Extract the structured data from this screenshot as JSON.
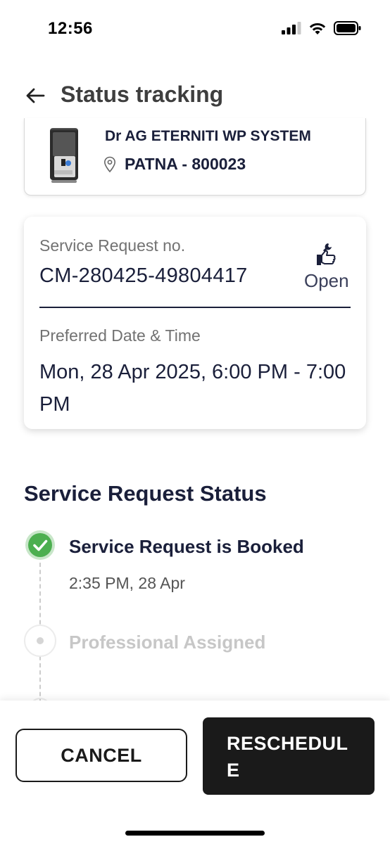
{
  "status_bar": {
    "time": "12:56",
    "icons": [
      "signal-icon",
      "wifi-icon",
      "battery-icon"
    ]
  },
  "header": {
    "back_icon": "arrow-left-icon",
    "title": "Status tracking"
  },
  "product": {
    "name": "Dr AG ETERNITI WP SYSTEM",
    "location": "PATNA - 800023",
    "location_icon": "map-pin-icon"
  },
  "request": {
    "label": "Service Request no.",
    "number": "CM-280425-49804417",
    "status": "Open",
    "status_icon": "thumbs-up-wrench-icon",
    "preferred_label": "Preferred Date & Time",
    "preferred_value": "Mon, 28 Apr 2025, 6:00 PM - 7:00 PM"
  },
  "timeline": {
    "title": "Service Request Status",
    "steps": [
      {
        "label": "Service Request is Booked",
        "time": "2:35 PM, 28 Apr",
        "state": "done"
      },
      {
        "label": "Professional Assigned",
        "state": "pending"
      }
    ]
  },
  "actions": {
    "cancel_label": "CANCEL",
    "reschedule_label": "RESCHEDULE"
  },
  "colors": {
    "text_primary": "#1a1f3a",
    "success_green": "#4caf50",
    "button_dark": "#1a1a1a"
  }
}
